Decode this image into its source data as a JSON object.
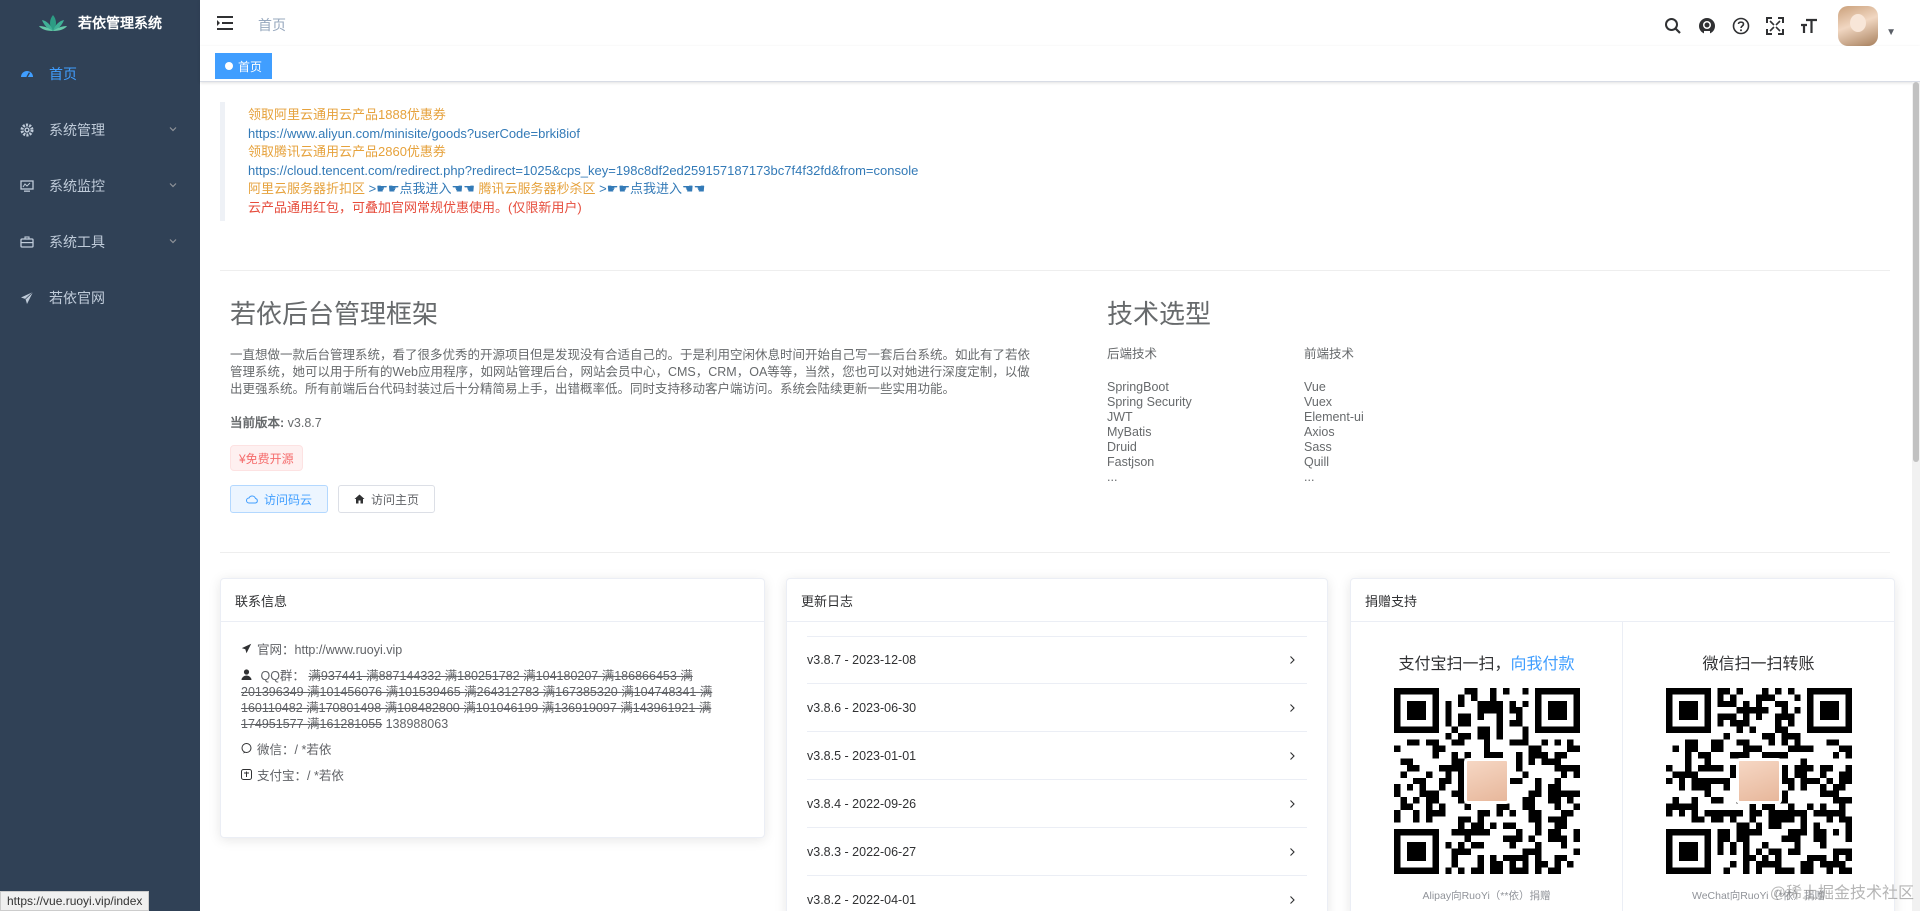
{
  "app": {
    "title": "若依管理系统"
  },
  "sidebar": {
    "items": [
      {
        "label": "首页",
        "icon": "dashboard-icon",
        "active": true
      },
      {
        "label": "系统管理",
        "icon": "gear-icon"
      },
      {
        "label": "系统监控",
        "icon": "monitor-icon"
      },
      {
        "label": "系统工具",
        "icon": "toolbox-icon"
      },
      {
        "label": "若依官网",
        "icon": "paper-plane-icon"
      }
    ]
  },
  "navbar": {
    "breadcrumb": "首页",
    "icons": [
      "search-icon",
      "github-icon",
      "help-icon",
      "fullscreen-icon",
      "font-size-icon"
    ]
  },
  "tags": {
    "active": "首页"
  },
  "notice": {
    "line1": "领取阿里云通用云产品1888优惠券",
    "line2": "https://www.aliyun.com/minisite/goods?userCode=brki8iof",
    "line3": "领取腾讯云通用云产品2860优惠券",
    "line4": "https://cloud.tencent.com/redirect.php?redirect=1025&cps_key=198c8df2ed259157187173bc7f4f32fd&from=console",
    "line5a": "阿里云服务器折扣区",
    "line5b": ">☛☛点我进入☚☚",
    "line5c": "腾讯云服务器秒杀区",
    "line5d": ">☛☛点我进入☚☚",
    "line6": "云产品通用红包，可叠加官网常规优惠使用。(仅限新用户)"
  },
  "intro": {
    "title": "若依后台管理框架",
    "desc": "一直想做一款后台管理系统，看了很多优秀的开源项目但是发现没有合适自己的。于是利用空闲休息时间开始自己写一套后台系统。如此有了若依管理系统，她可以用于所有的Web应用程序，如网站管理后台，网站会员中心，CMS，CRM，OA等等，当然，您也可以对她进行深度定制，以做出更强系统。所有前端后台代码封装过后十分精简易上手，出错概率低。同时支持移动客户端访问。系统会陆续更新一些实用功能。",
    "version_label": "当前版本:",
    "version": "v3.8.7",
    "free_tag": "¥免费开源",
    "btn_gitee": "访问码云",
    "btn_home": "访问主页"
  },
  "tech": {
    "title": "技术选型",
    "backend_head": "后端技术",
    "frontend_head": "前端技术",
    "backend": [
      "SpringBoot",
      "Spring Security",
      "JWT",
      "MyBatis",
      "Druid",
      "Fastjson",
      "..."
    ],
    "frontend": [
      "Vue",
      "Vuex",
      "Element-ui",
      "Axios",
      "Sass",
      "Quill",
      "..."
    ]
  },
  "contact": {
    "header": "联系信息",
    "site_label": "官网：",
    "site": "http://www.ruoyi.vip",
    "qq_label": "QQ群：",
    "qq_struck": "满937441 满887144332 满180251782 满104180207 满186866453 满201396349 满101456076 满101539465 满264312783 满167385320 满104748341 满160110482 满170801498 满108482800 满101046199 满136919097 满143961921 满174951577 满161281055",
    "qq_open": "138988063",
    "wechat_label": "微信：",
    "wechat": "/ *若依",
    "alipay_label": "支付宝：",
    "alipay": "/ *若依"
  },
  "changelog": {
    "header": "更新日志",
    "items": [
      "v3.8.7 - 2023-12-08",
      "v3.8.6 - 2023-06-30",
      "v3.8.5 - 2023-01-01",
      "v3.8.4 - 2022-09-26",
      "v3.8.3 - 2022-06-27",
      "v3.8.2 - 2022-04-01"
    ]
  },
  "donate": {
    "header": "捐赠支持",
    "alipay_title": "支付宝扫一扫，",
    "alipay_highlight": "向我付款",
    "alipay_caption": "Alipay向RuoYi（**依）捐赠",
    "wechat_title": "微信扫一扫转账",
    "wechat_caption": "WeChat向RuoYi（*依）捐赠"
  },
  "watermark": "@稀土掘金技术社区",
  "statusbar": "https://vue.ruoyi.vip/index",
  "colors": {
    "sidebar_bg": "#304156",
    "accent": "#409eff",
    "notice_orange": "#e6a23c",
    "notice_blue": "#337ab7",
    "notice_red": "#e64c3c"
  }
}
